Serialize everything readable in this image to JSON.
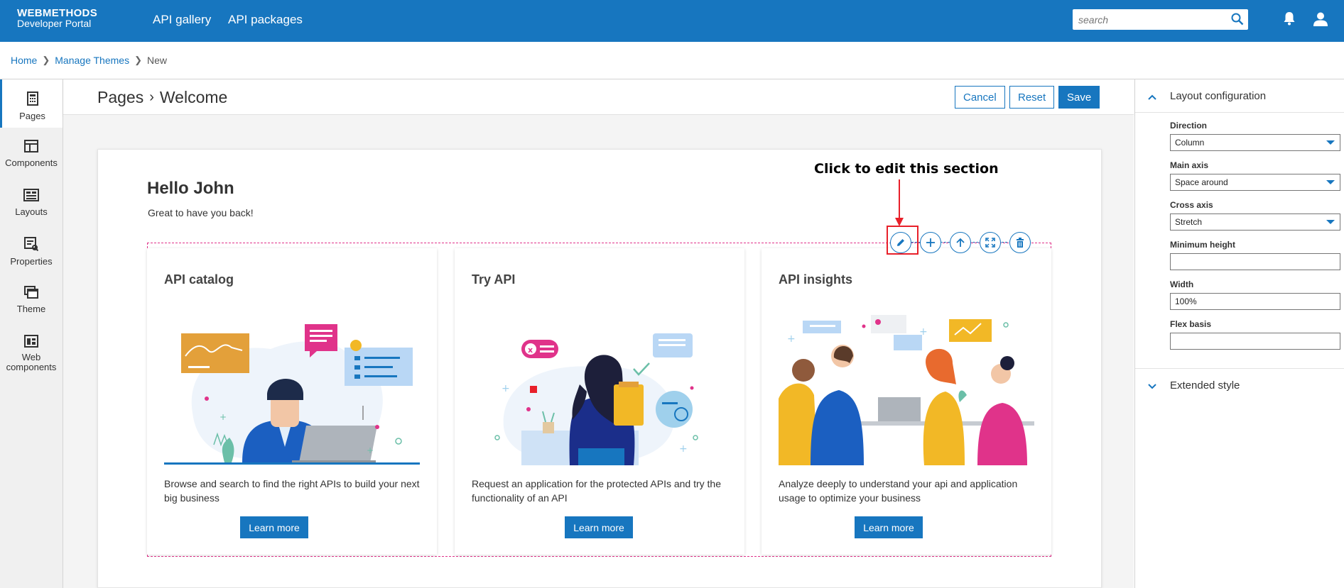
{
  "topbar": {
    "brand_line1": "WEBMETHODS",
    "brand_line2": "Developer Portal",
    "nav": [
      "API gallery",
      "API packages"
    ],
    "search_placeholder": "search"
  },
  "breadcrumb": {
    "items": [
      "Home",
      "Manage Themes",
      "New"
    ]
  },
  "sidebar": {
    "items": [
      {
        "label": "Pages",
        "icon": "pages-icon"
      },
      {
        "label": "Components",
        "icon": "components-icon"
      },
      {
        "label": "Layouts",
        "icon": "layouts-icon"
      },
      {
        "label": "Properties",
        "icon": "properties-icon"
      },
      {
        "label": "Theme",
        "icon": "theme-icon"
      },
      {
        "label": "Web components",
        "icon": "web-components-icon"
      }
    ]
  },
  "header": {
    "title_parent": "Pages",
    "title_current": "Welcome",
    "cancel_label": "Cancel",
    "reset_label": "Reset",
    "save_label": "Save"
  },
  "welcome": {
    "greeting": "Hello John",
    "subtitle": "Great to have you back!"
  },
  "annotation": {
    "text": "Click to edit this section"
  },
  "tiles": [
    {
      "title": "API catalog",
      "description": "Browse and search to find the right APIs to build your next big business",
      "button": "Learn more"
    },
    {
      "title": "Try API",
      "description": "Request an application for the protected APIs and try the functionality of an API",
      "button": "Learn more"
    },
    {
      "title": "API insights",
      "description": "Analyze deeply to understand your api and application usage to optimize your business",
      "button": "Learn more"
    }
  ],
  "right_panel": {
    "layout_heading": "Layout configuration",
    "fields": [
      {
        "label": "Direction",
        "value": "Column",
        "type": "select"
      },
      {
        "label": "Main axis",
        "value": "Space around",
        "type": "select"
      },
      {
        "label": "Cross axis",
        "value": "Stretch",
        "type": "select"
      },
      {
        "label": "Minimum height",
        "value": "",
        "type": "text"
      },
      {
        "label": "Width",
        "value": "100%",
        "type": "text"
      },
      {
        "label": "Flex basis",
        "value": "",
        "type": "text"
      }
    ],
    "extended_heading": "Extended style"
  },
  "colors": {
    "brand": "#1776bf",
    "section_outline": "#e0338a",
    "annotation": "#e8202a"
  }
}
